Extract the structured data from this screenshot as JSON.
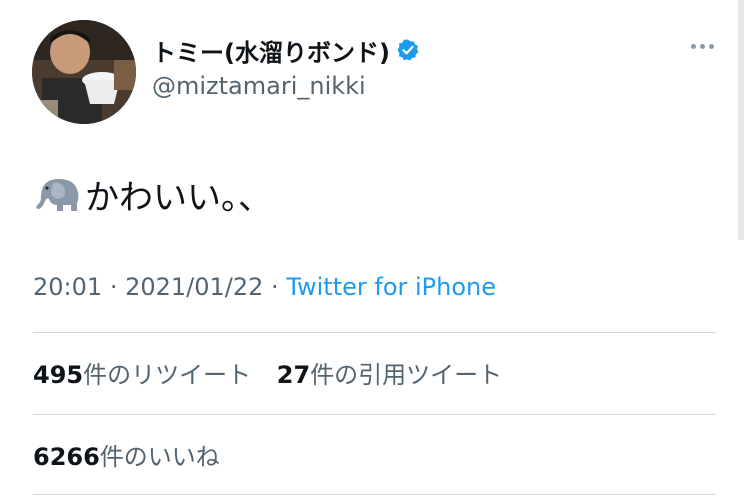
{
  "tweet": {
    "author": {
      "display_name": "トミー(水溜りボンド)",
      "handle": "@miztamari_nikki",
      "verified": true,
      "avatar_icon": "profile-photo"
    },
    "more_icon": "more-options-icon",
    "text_emoji": "elephant-emoji",
    "text": "かわいい。、",
    "timestamp": {
      "time": "20:01",
      "date": "2021/01/22",
      "source": "Twitter for iPhone"
    },
    "stats": {
      "retweets_count": "495",
      "retweets_label": "件のリツイート",
      "quotes_count": "27",
      "quotes_label": "件の引用ツイート",
      "likes_count": "6266",
      "likes_label": "件のいいね"
    }
  },
  "colors": {
    "text": "#0f1419",
    "secondary": "#536471",
    "link": "#1d9bf0",
    "divider": "#cfd9de"
  }
}
